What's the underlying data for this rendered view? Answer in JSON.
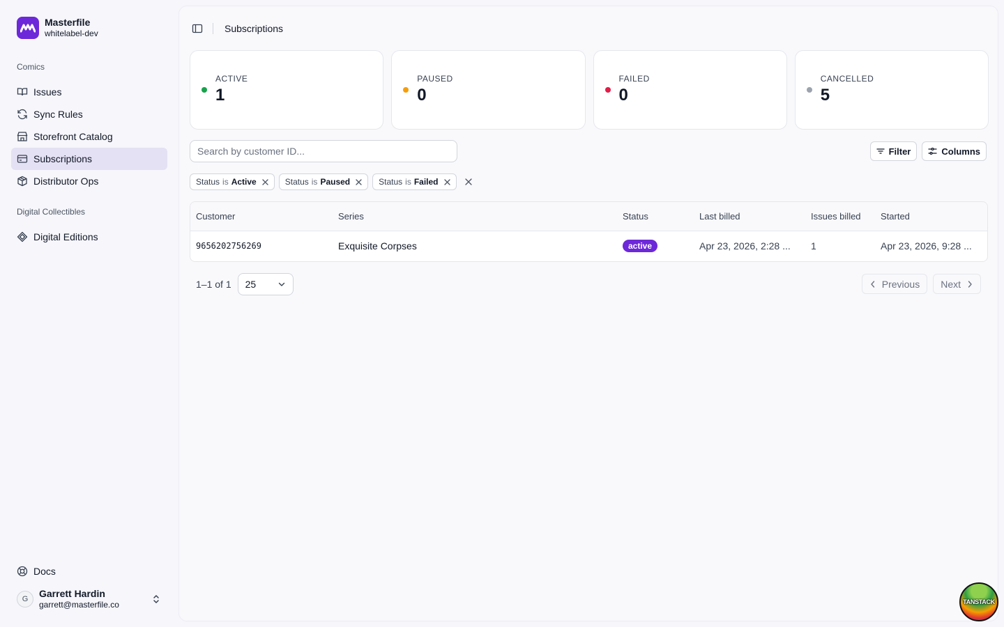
{
  "brand": {
    "name": "Masterfile",
    "workspace": "whitelabel-dev"
  },
  "sidebar": {
    "sections": [
      {
        "heading": "Comics",
        "items": [
          {
            "label": "Issues",
            "icon": "book-open-icon"
          },
          {
            "label": "Sync Rules",
            "icon": "refresh-icon"
          },
          {
            "label": "Storefront Catalog",
            "icon": "store-icon"
          },
          {
            "label": "Subscriptions",
            "icon": "credit-card-icon",
            "active": true
          },
          {
            "label": "Distributor Ops",
            "icon": "package-icon"
          }
        ]
      },
      {
        "heading": "Digital Collectibles",
        "items": [
          {
            "label": "Digital Editions",
            "icon": "gem-icon"
          }
        ]
      }
    ],
    "docs_label": "Docs",
    "user": {
      "initial": "G",
      "name": "Garrett Hardin",
      "email": "garrett@masterfile.co"
    }
  },
  "header": {
    "title": "Subscriptions"
  },
  "stats": [
    {
      "label": "ACTIVE",
      "value": "1",
      "color": "#16a34a"
    },
    {
      "label": "PAUSED",
      "value": "0",
      "color": "#f59e0b"
    },
    {
      "label": "FAILED",
      "value": "0",
      "color": "#e11d48"
    },
    {
      "label": "CANCELLED",
      "value": "5",
      "color": "#9ca3af"
    }
  ],
  "search": {
    "placeholder": "Search by customer ID...",
    "value": ""
  },
  "toolbar": {
    "filter_label": "Filter",
    "columns_label": "Columns"
  },
  "filters": [
    {
      "key": "Status",
      "op": "is",
      "value": "Active"
    },
    {
      "key": "Status",
      "op": "is",
      "value": "Paused"
    },
    {
      "key": "Status",
      "op": "is",
      "value": "Failed"
    }
  ],
  "table": {
    "columns": [
      "Customer",
      "Series",
      "Status",
      "Last billed",
      "Issues billed",
      "Started"
    ],
    "rows": [
      {
        "customer": "9656202756269",
        "series": "Exquisite Corpses",
        "status": "active",
        "last_billed": "Apr 23, 2026, 2:28 ...",
        "issues_billed": "1",
        "started": "Apr 23, 2026, 9:28 ..."
      }
    ]
  },
  "pagination": {
    "range": "1–1 of 1",
    "page_size": "25",
    "previous_label": "Previous",
    "next_label": "Next"
  },
  "devtools": {
    "label": "TANSTACK"
  },
  "colors": {
    "accent": "#6d28d9",
    "active_nav_bg": "#e4e1f4"
  }
}
